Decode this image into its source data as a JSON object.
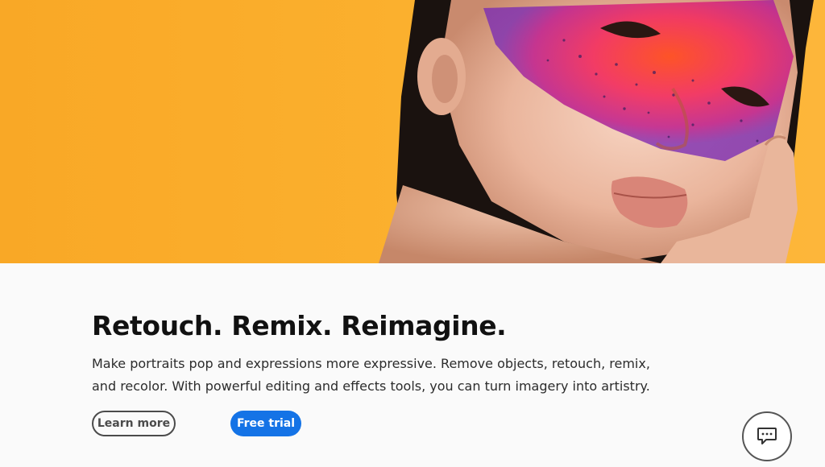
{
  "hero": {
    "image_description_icon": "portrait-photo",
    "background_color": "#fbb22f"
  },
  "main": {
    "headline": "Retouch. Remix. Reimagine.",
    "description": "Make portraits pop and expressions more expressive. Remove objects, retouch, remix, and recolor. With powerful editing and effects tools, you can turn imagery into artistry.",
    "learn_more_label": "Learn more",
    "free_trial_label": "Free trial"
  },
  "chat": {
    "icon": "chat-bubble-icon"
  },
  "colors": {
    "accent": "#1473e6",
    "headline": "#111111",
    "body": "#2c2c2c",
    "outline_button": "#4b4b4b"
  }
}
